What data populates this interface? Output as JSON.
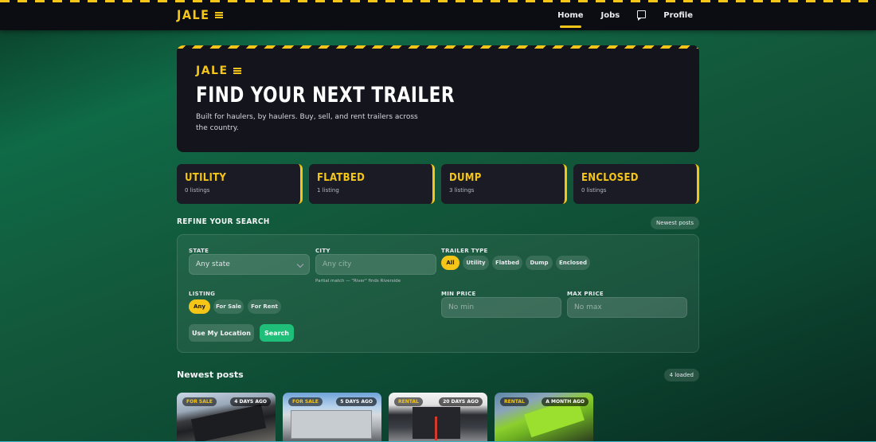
{
  "nav": {
    "brand": "JALE",
    "items": [
      "Home",
      "Jobs",
      "Profile"
    ],
    "active": "Home"
  },
  "hero": {
    "brand": "JALE",
    "title": "FIND YOUR NEXT TRAILER",
    "subtitle": "Built for haulers, by haulers. Buy, sell, and rent trailers across the country."
  },
  "categories": [
    {
      "name": "UTILITY",
      "count": "0 listings"
    },
    {
      "name": "FLATBED",
      "count": "1 listing"
    },
    {
      "name": "DUMP",
      "count": "3 listings"
    },
    {
      "name": "ENCLOSED",
      "count": "0 listings"
    }
  ],
  "refine": {
    "title": "REFINE YOUR SEARCH",
    "sort_chip": "Newest posts",
    "state_label": "STATE",
    "state_value": "Any state",
    "city_label": "CITY",
    "city_placeholder": "Any city",
    "city_hint": "Partial match — \"River\" finds Riverside",
    "trailer_type_label": "TRAILER TYPE",
    "trailer_types": [
      "All",
      "Utility",
      "Flatbed",
      "Dump",
      "Enclosed"
    ],
    "trailer_type_selected": "All",
    "listing_label": "LISTING",
    "listing_options": [
      "Any",
      "For Sale",
      "For Rent"
    ],
    "listing_selected": "Any",
    "min_price_label": "MIN PRICE",
    "min_price_placeholder": "No min",
    "max_price_label": "MAX PRICE",
    "max_price_placeholder": "No max",
    "location_button": "Use My Location",
    "search_button": "Search"
  },
  "posts": {
    "title": "Newest posts",
    "loaded_chip": "4 loaded",
    "items": [
      {
        "tag": "FOR SALE",
        "age": "4 DAYS AGO"
      },
      {
        "tag": "FOR SALE",
        "age": "5 DAYS AGO"
      },
      {
        "tag": "RENTAL",
        "age": "20 DAYS AGO"
      },
      {
        "tag": "RENTAL",
        "age": "A MONTH AGO"
      }
    ]
  },
  "colors": {
    "accent": "#f5c518",
    "search_button": "#1fbf7a",
    "nav_bg": "#0c0d12",
    "card_bg": "#1a1b24"
  }
}
